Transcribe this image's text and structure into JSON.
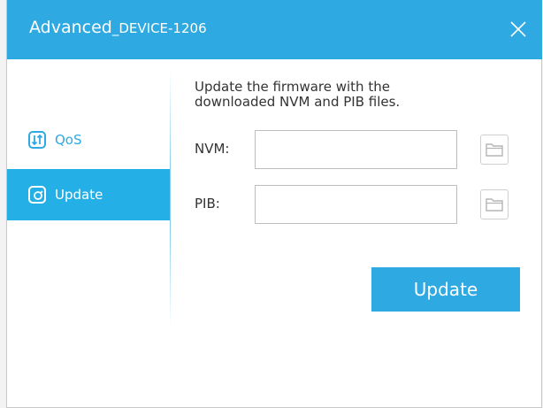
{
  "window": {
    "title_prefix": "Advanced",
    "title_device": "_DEVICE-1206"
  },
  "sidebar": {
    "items": [
      {
        "label": "QoS",
        "icon": "qos-icon",
        "active": false
      },
      {
        "label": "Update",
        "icon": "update-icon",
        "active": true
      }
    ]
  },
  "update": {
    "description_line1": "Update the firmware with the",
    "description_line2": "downloaded NVM and PIB files.",
    "nvm_label": "NVM:",
    "nvm_value": "",
    "pib_label": "PIB:",
    "pib_value": "",
    "button_label": "Update"
  },
  "colors": {
    "accent": "#2fa9e1",
    "active_nav": "#24b0e6",
    "text": "#333333"
  }
}
